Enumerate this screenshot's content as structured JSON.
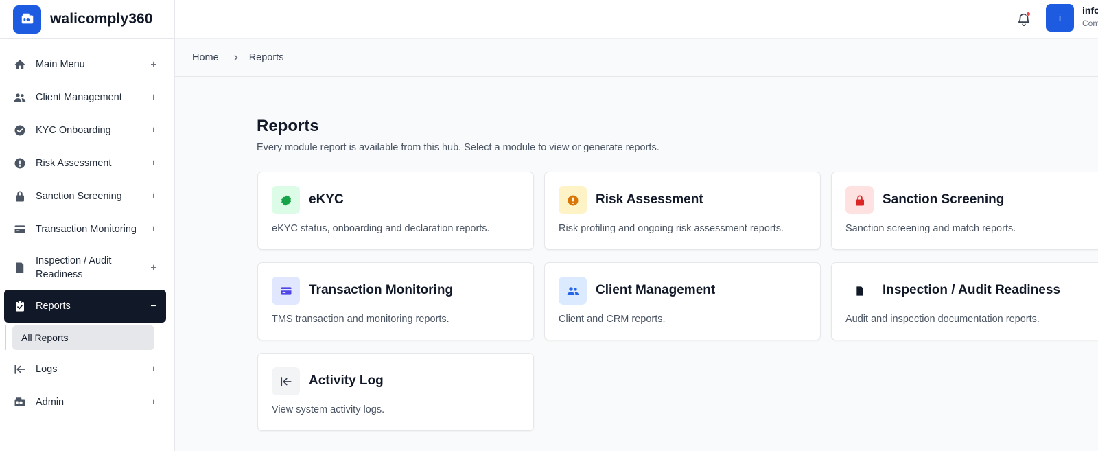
{
  "brand": {
    "name": "walicomply360",
    "color": "#1d5be0"
  },
  "sidebar": {
    "items": [
      {
        "label": "Main Menu",
        "icon": "home-icon",
        "toggle": "+"
      },
      {
        "label": "Client Management",
        "icon": "users-icon",
        "toggle": "+"
      },
      {
        "label": "KYC Onboarding",
        "icon": "check-badge-icon",
        "toggle": "+"
      },
      {
        "label": "Risk Assessment",
        "icon": "alert-circle-icon",
        "toggle": "+"
      },
      {
        "label": "Sanction Screening",
        "icon": "lock-icon",
        "toggle": "+"
      },
      {
        "label": "Transaction Monitoring",
        "icon": "credit-card-icon",
        "toggle": "+"
      },
      {
        "label": "Inspection / Audit Readiness",
        "icon": "document-icon",
        "toggle": "+"
      },
      {
        "label": "Reports",
        "icon": "clipboard-check-icon",
        "toggle": "−",
        "active": true
      },
      {
        "label": "Logs",
        "icon": "arrow-left-bar-icon",
        "toggle": "+"
      },
      {
        "label": "Admin",
        "icon": "admin-icon",
        "toggle": "+"
      }
    ],
    "subitems": [
      {
        "label": "All Reports"
      }
    ]
  },
  "topbar": {
    "notification_icon": "bell-icon",
    "avatar_initial": "i",
    "user_name": "info",
    "user_role": "Com"
  },
  "breadcrumb": {
    "home": "Home",
    "current": "Reports"
  },
  "main": {
    "title": "Reports",
    "subtitle": "Every module report is available from this hub. Select a module to view or generate reports.",
    "cards": [
      {
        "title": "eKYC",
        "description": "eKYC status, onboarding and declaration reports.",
        "icon": "badge-icon",
        "icon_bg": "#dcfce7",
        "icon_color": "#16a34a"
      },
      {
        "title": "Risk Assessment",
        "description": "Risk profiling and ongoing risk assessment reports.",
        "icon": "alert-circle-icon",
        "icon_bg": "#fef3c7",
        "icon_color": "#d97706"
      },
      {
        "title": "Sanction Screening",
        "description": "Sanction screening and match reports.",
        "icon": "lock-icon",
        "icon_bg": "#fee2e2",
        "icon_color": "#dc2626"
      },
      {
        "title": "Transaction Monitoring",
        "description": "TMS transaction and monitoring reports.",
        "icon": "credit-card-icon",
        "icon_bg": "#e0e7ff",
        "icon_color": "#4f46e5"
      },
      {
        "title": "Client Management",
        "description": "Client and CRM reports.",
        "icon": "users-icon",
        "icon_bg": "#dbeafe",
        "icon_color": "#2563eb"
      },
      {
        "title": "Inspection / Audit Readiness",
        "description": "Audit and inspection documentation reports.",
        "icon": "document-icon",
        "icon_bg": "#ffffff",
        "icon_color": "#111827"
      },
      {
        "title": "Activity Log",
        "description": "View system activity logs.",
        "icon": "arrow-left-bar-icon",
        "icon_bg": "#f3f4f6",
        "icon_color": "#374151"
      }
    ]
  }
}
